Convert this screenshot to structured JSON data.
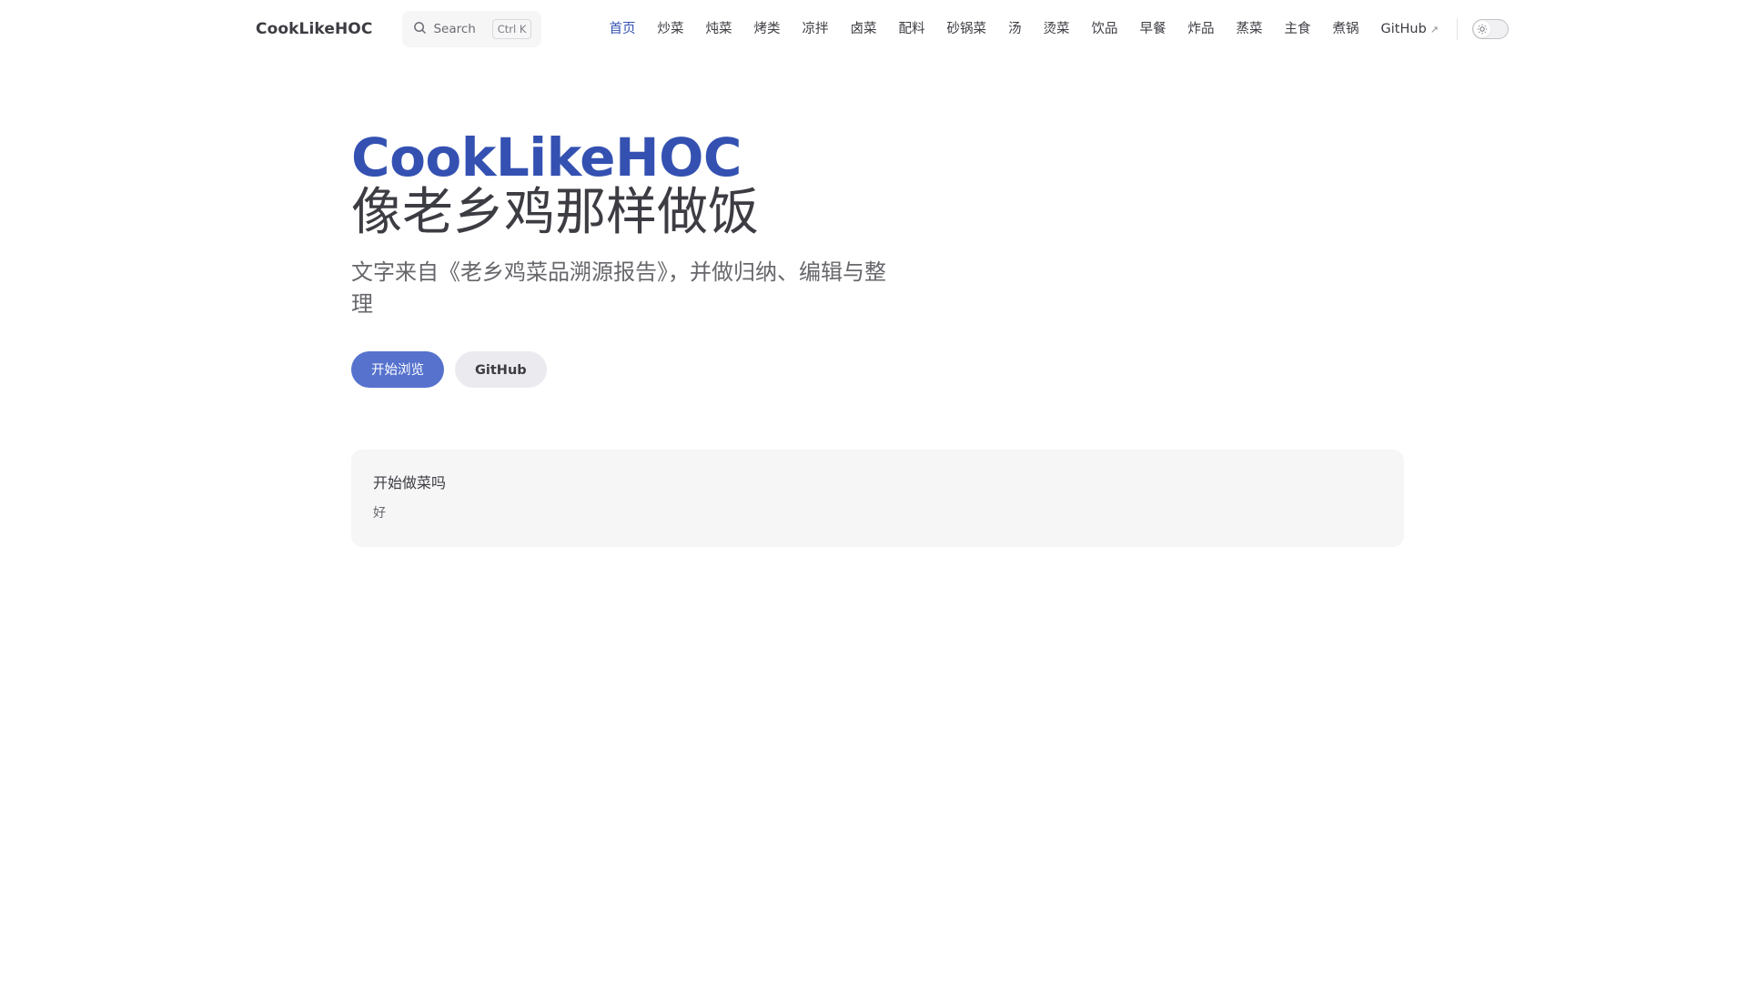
{
  "nav": {
    "title": "CookLikeHOC",
    "search": {
      "placeholder": "Search",
      "shortcut": "Ctrl K",
      "icon": "search-icon"
    },
    "links": [
      {
        "label": "首页",
        "active": true
      },
      {
        "label": "炒菜"
      },
      {
        "label": "炖菜"
      },
      {
        "label": "烤类"
      },
      {
        "label": "凉拌"
      },
      {
        "label": "卤菜"
      },
      {
        "label": "配料"
      },
      {
        "label": "砂锅菜"
      },
      {
        "label": "汤"
      },
      {
        "label": "烫菜"
      },
      {
        "label": "饮品"
      },
      {
        "label": "早餐"
      },
      {
        "label": "炸品"
      },
      {
        "label": "蒸菜"
      },
      {
        "label": "主食"
      },
      {
        "label": "煮锅"
      }
    ],
    "github": {
      "label": "GitHub",
      "ext_icon": "↗"
    },
    "theme_toggle": {
      "icon": "sun-icon",
      "mode": "light"
    }
  },
  "hero": {
    "name": "CookLikeHOC",
    "text": "像老乡鸡那样做饭",
    "tagline": "文字来自《老乡鸡菜品溯源报告》，并做归纳、编辑与整理",
    "actions": [
      {
        "label": "开始浏览",
        "theme": "brand"
      },
      {
        "label": "GitHub",
        "theme": "alt"
      }
    ]
  },
  "feature": {
    "title": "开始做菜吗",
    "details": "好"
  },
  "colors": {
    "brand": "#3451b2",
    "brand_button": "#5672cd",
    "text": "#3c3c43",
    "muted": "#67676c",
    "soft_bg": "#f6f6f7"
  }
}
